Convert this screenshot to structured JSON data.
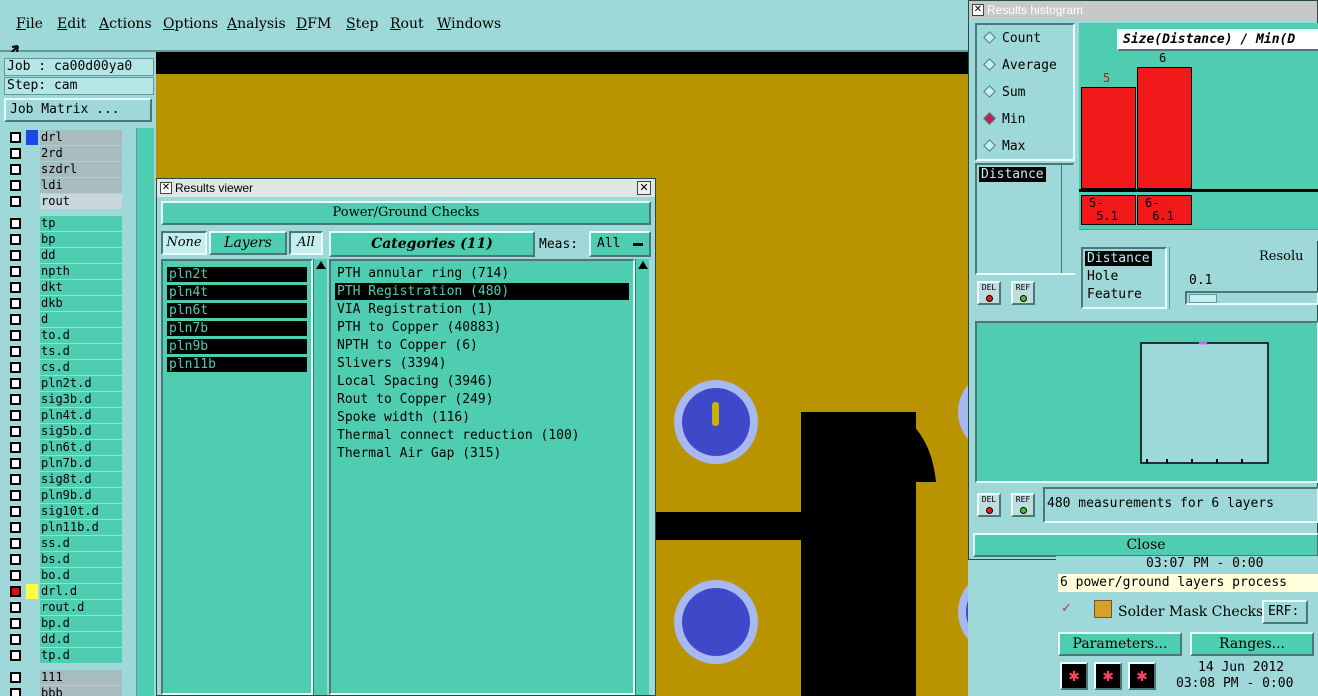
{
  "menu": [
    "File",
    "Edit",
    "Actions",
    "Options",
    "Analysis",
    "DFM",
    "Step",
    "Rout",
    "Windows"
  ],
  "left": {
    "job": "Job : ca00d00ya0",
    "step": "Step: cam",
    "job_matrix": "Job Matrix ..."
  },
  "layers_top": [
    {
      "name": "drl",
      "style": "gray"
    },
    {
      "name": "2rd",
      "style": "gray"
    },
    {
      "name": "szdrl",
      "style": "gray"
    },
    {
      "name": "ldi",
      "style": "gray"
    },
    {
      "name": "rout",
      "style": "light"
    }
  ],
  "layers": [
    {
      "name": "tp",
      "style": "teal"
    },
    {
      "name": "bp",
      "style": "teal"
    },
    {
      "name": "dd",
      "style": "teal"
    },
    {
      "name": "npth",
      "style": "teal"
    },
    {
      "name": "dkt",
      "style": "teal"
    },
    {
      "name": "dkb",
      "style": "teal"
    },
    {
      "name": "d",
      "style": "teal"
    },
    {
      "name": "to.d",
      "style": "teal"
    },
    {
      "name": "ts.d",
      "style": "teal"
    },
    {
      "name": "cs.d",
      "style": "teal"
    },
    {
      "name": "pln2t.d",
      "style": "teal"
    },
    {
      "name": "sig3b.d",
      "style": "teal"
    },
    {
      "name": "pln4t.d",
      "style": "teal"
    },
    {
      "name": "sig5b.d",
      "style": "teal"
    },
    {
      "name": "pln6t.d",
      "style": "teal"
    },
    {
      "name": "pln7b.d",
      "style": "teal"
    },
    {
      "name": "sig8t.d",
      "style": "teal"
    },
    {
      "name": "pln9b.d",
      "style": "teal"
    },
    {
      "name": "sig10t.d",
      "style": "teal"
    },
    {
      "name": "pln11b.d",
      "style": "teal"
    },
    {
      "name": "ss.d",
      "style": "teal"
    },
    {
      "name": "bs.d",
      "style": "teal"
    },
    {
      "name": "bo.d",
      "style": "teal"
    },
    {
      "name": "drl.d",
      "style": "teal"
    },
    {
      "name": "rout.d",
      "style": "teal"
    },
    {
      "name": "bp.d",
      "style": "teal"
    },
    {
      "name": "dd.d",
      "style": "teal"
    },
    {
      "name": "tp.d",
      "style": "teal"
    }
  ],
  "layers_bottom": [
    {
      "name": "111",
      "style": "gray"
    },
    {
      "name": "bbb",
      "style": "gray"
    }
  ],
  "results_viewer": {
    "title": "Results viewer",
    "header": "Power/Ground Checks",
    "none_btn": "None",
    "layers_btn": "Layers",
    "all_btn": "All",
    "categories_btn": "Categories (11)",
    "meas_label": "Meas:",
    "meas_value": "All",
    "layer_items": [
      "pln2t",
      "pln4t",
      "pln6t",
      "pln7b",
      "pln9b",
      "pln11b"
    ],
    "categories": [
      "PTH annular ring (714)",
      "PTH Registration (480)",
      "VIA Registration (1)",
      "PTH to Copper (40883)",
      "NPTH to Copper (6)",
      "Slivers (3394)",
      "Local Spacing (3946)",
      "Rout to Copper (249)",
      "Spoke width (116)",
      "Thermal connect reduction (100)",
      "Thermal Air Gap (315)"
    ],
    "selected_category": 1
  },
  "histogram": {
    "title": "Results histogram",
    "modes": [
      "Count",
      "Average",
      "Sum",
      "Min",
      "Max"
    ],
    "selected_mode": "Min",
    "chart_title": "Size(Distance) / Min(D",
    "bars": [
      {
        "label": "5",
        "value": 5,
        "range": "5-\n 5.1"
      },
      {
        "label": "6",
        "value": 6,
        "range": "6-\n 6.1"
      }
    ],
    "measure_list": [
      "Distance"
    ],
    "measure_types": [
      "Distance",
      "Hole",
      "Feature"
    ],
    "resolution_label": "Resolu",
    "resolution_value": "0.1",
    "del_label": "DEL",
    "ref_label": "REF",
    "status": "480 measurements for 6 layers",
    "close": "Close"
  },
  "bottom_right": {
    "line1": "03:07 PM - 0:00",
    "notice": "6 power/ground layers process",
    "solder_mask": "Solder Mask Checks",
    "erf": "ERF:",
    "parameters": "Parameters...",
    "ranges": "Ranges...",
    "date": "14 Jun 2012",
    "time": "03:08 PM - 0:00"
  },
  "colors": {
    "ui_bg": "#9fd8d8",
    "teal": "#4fcdb1",
    "copper": "#b99400",
    "pad": "#3f48c8",
    "pad_ring": "#a8b8f0",
    "bar": "#f01818"
  }
}
